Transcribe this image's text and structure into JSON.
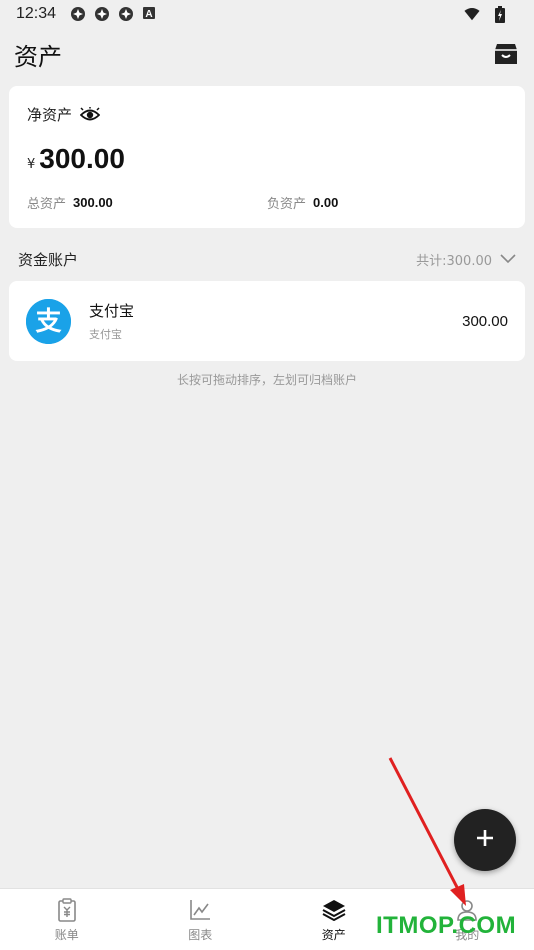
{
  "status_bar": {
    "time": "12:34",
    "icons": [
      "sync-icon",
      "sync-icon",
      "sync-icon",
      "a-badge-icon",
      "wifi-icon",
      "battery-icon"
    ],
    "badge_letter": "A"
  },
  "header": {
    "title": "资产",
    "action_icon": "archive-box-icon"
  },
  "net_assets": {
    "label": "净资产",
    "visibility_icon": "eye-icon",
    "currency": "¥",
    "amount": "300.00",
    "total_label": "总资产",
    "total_value": "300.00",
    "liability_label": "负资产",
    "liability_value": "0.00"
  },
  "accounts_section": {
    "title": "资金账户",
    "total_text": "共计:300.00",
    "toggle_icon": "chevron-down-icon"
  },
  "accounts": [
    {
      "name": "支付宝",
      "sub": "支付宝",
      "balance": "300.00",
      "logo_char": "支",
      "logo_color": "#1aa2e8"
    }
  ],
  "hint": "长按可拖动排序，左划可归档账户",
  "fab": {
    "icon": "plus-icon"
  },
  "tabs": [
    {
      "label": "账单",
      "icon": "bill-icon",
      "active": false
    },
    {
      "label": "图表",
      "icon": "chart-icon",
      "active": false
    },
    {
      "label": "资产",
      "icon": "layers-icon",
      "active": true
    },
    {
      "label": "我的",
      "icon": "user-icon",
      "active": false
    }
  ],
  "watermark": "ITMOP.COM",
  "colors": {
    "background": "#efefef",
    "card": "#ffffff",
    "accent_dark": "#222222",
    "alipay_blue": "#1aa2e8",
    "muted_text": "#999999",
    "watermark_green": "#22b33a",
    "arrow_red": "#e02020"
  }
}
